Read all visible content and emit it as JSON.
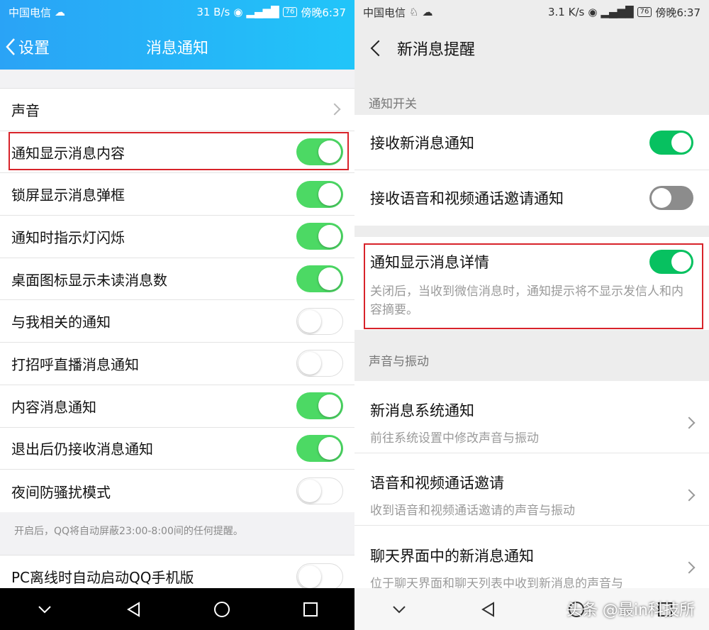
{
  "qq": {
    "status": {
      "carrier": "中国电信",
      "speed": "31 B/s",
      "battery": "76",
      "time": "傍晚6:37"
    },
    "header": {
      "back_label": "设置",
      "title": "消息通知"
    },
    "rows": [
      {
        "label": "声音",
        "type": "chevron"
      },
      {
        "label": "通知显示消息内容",
        "type": "toggle",
        "state": "on"
      },
      {
        "label": "锁屏显示消息弹框",
        "type": "toggle",
        "state": "on"
      },
      {
        "label": "通知时指示灯闪烁",
        "type": "toggle",
        "state": "on"
      },
      {
        "label": "桌面图标显示未读消息数",
        "type": "toggle",
        "state": "on"
      },
      {
        "label": "与我相关的通知",
        "type": "toggle",
        "state": "off"
      },
      {
        "label": "打招呼直播消息通知",
        "type": "toggle",
        "state": "off"
      },
      {
        "label": "内容消息通知",
        "type": "toggle",
        "state": "on"
      },
      {
        "label": "退出后仍接收消息通知",
        "type": "toggle",
        "state": "on"
      },
      {
        "label": "夜间防骚扰模式",
        "type": "toggle",
        "state": "off"
      }
    ],
    "note": "开启后，QQ将自动屏蔽23:00-8:00间的任何提醒。",
    "pc_row": {
      "label": "PC离线时自动启动QQ手机版",
      "state": "off"
    }
  },
  "wechat": {
    "status": {
      "carrier": "中国电信",
      "speed": "3.1 K/s",
      "battery": "76",
      "time": "傍晚6:37"
    },
    "header": {
      "title": "新消息提醒"
    },
    "section1": "通知开关",
    "row_receive": {
      "label": "接收新消息通知",
      "state": "on"
    },
    "row_voice": {
      "label": "接收语音和视频通话邀请通知",
      "state": "off"
    },
    "detail": {
      "label": "通知显示消息详情",
      "state": "on",
      "desc": "关闭后，当收到微信消息时，通知提示将不显示发信人和内容摘要。"
    },
    "section2": "声音与振动",
    "rows2": [
      {
        "title": "新消息系统通知",
        "sub": "前往系统设置中修改声音与振动"
      },
      {
        "title": "语音和视频通话邀请",
        "sub": "收到语音和视频通话邀请的声音与振动"
      },
      {
        "title": "聊天界面中的新消息通知",
        "sub": "位于聊天界面和聊天列表中收到新消息的声音与"
      }
    ]
  },
  "watermark": "头条 @最in科技所",
  "colors": {
    "qq_blue": "#2aa3f6",
    "ios_green": "#4cd964",
    "wechat_green": "#07c160",
    "highlight_red": "#d8232a"
  }
}
